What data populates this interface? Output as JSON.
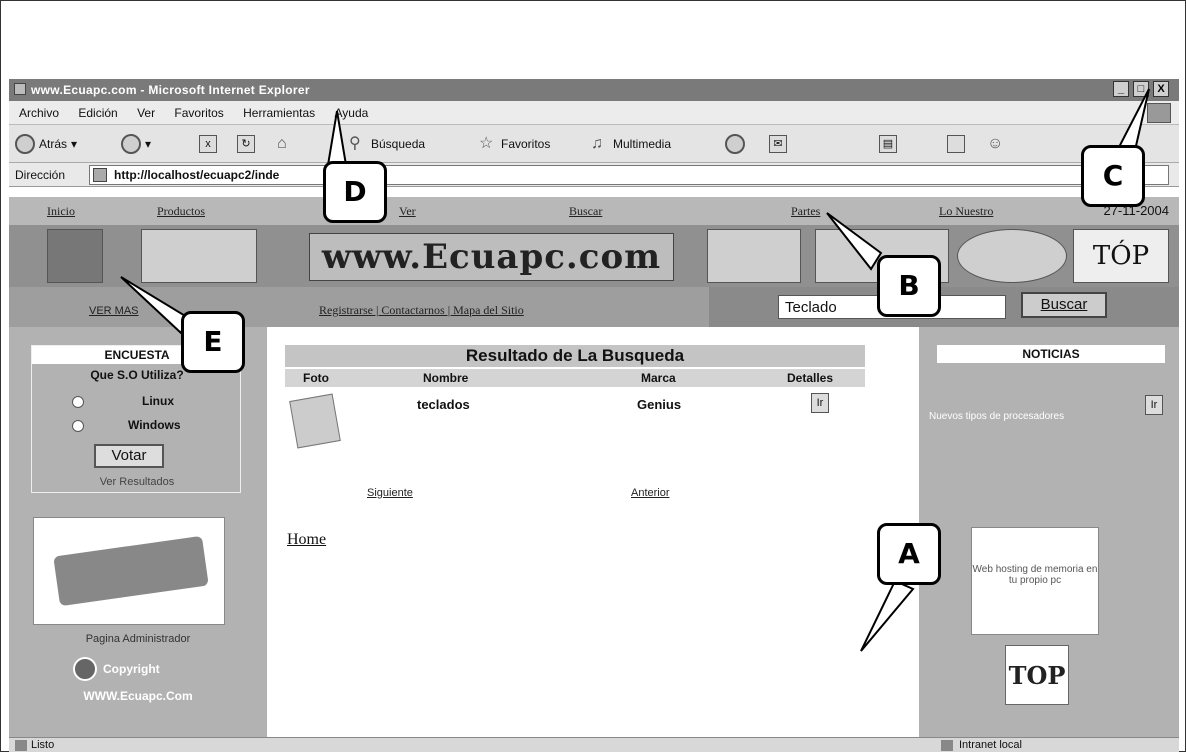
{
  "window": {
    "title": "www.Ecuapc.com - Microsoft Internet Explorer",
    "controls": [
      "_",
      "□",
      "X"
    ]
  },
  "menu": [
    "Archivo",
    "Edición",
    "Ver",
    "Favoritos",
    "Herramientas",
    "Ayuda"
  ],
  "toolbar": {
    "back": "Atrás",
    "search": "Búsqueda",
    "favorites": "Favoritos",
    "media": "Multimedia"
  },
  "address": {
    "label": "Dirección",
    "url": "http://localhost/ecuapc2/inde"
  },
  "site_nav": {
    "items": [
      "Inicio",
      "Productos",
      "Ver",
      "Buscar",
      "Partes",
      "Lo Nuestro"
    ],
    "date": "27-11-2004"
  },
  "banner": {
    "logo": "www.Ecuapc.com",
    "top": "TÓP"
  },
  "search_row": {
    "left_link": "VER MAS",
    "links": "Registrarse | Contactarnos | Mapa del Sitio",
    "query": "Teclado",
    "button": "Buscar"
  },
  "poll": {
    "title": "ENCUESTA",
    "question": "Que S.O Utiliza?",
    "options": [
      "Linux",
      "Windows"
    ],
    "vote_button": "Votar",
    "results_link": "Ver Resultados"
  },
  "left_footer": {
    "admin": "Pagina Administrador",
    "copyright": "Copyright",
    "site": "WWW.Ecuapc.Com"
  },
  "results": {
    "title": "Resultado de La Busqueda",
    "columns": [
      "Foto",
      "Nombre",
      "Marca",
      "Detalles"
    ],
    "rows": [
      {
        "name": "teclados",
        "brand": "Genius",
        "detail_button": "Ir"
      }
    ],
    "next": "Siguiente",
    "previous": "Anterior",
    "home": "Home"
  },
  "news": {
    "title": "NOTICIAS",
    "item": "Nuevos tipos de procesadores",
    "button": "Ir",
    "ad": "Web hosting de memoria en tu propio pc",
    "badge": "TOP"
  },
  "status": {
    "left": "Listo",
    "right": "Intranet local"
  },
  "callouts": [
    "A",
    "B",
    "C",
    "D",
    "E"
  ]
}
